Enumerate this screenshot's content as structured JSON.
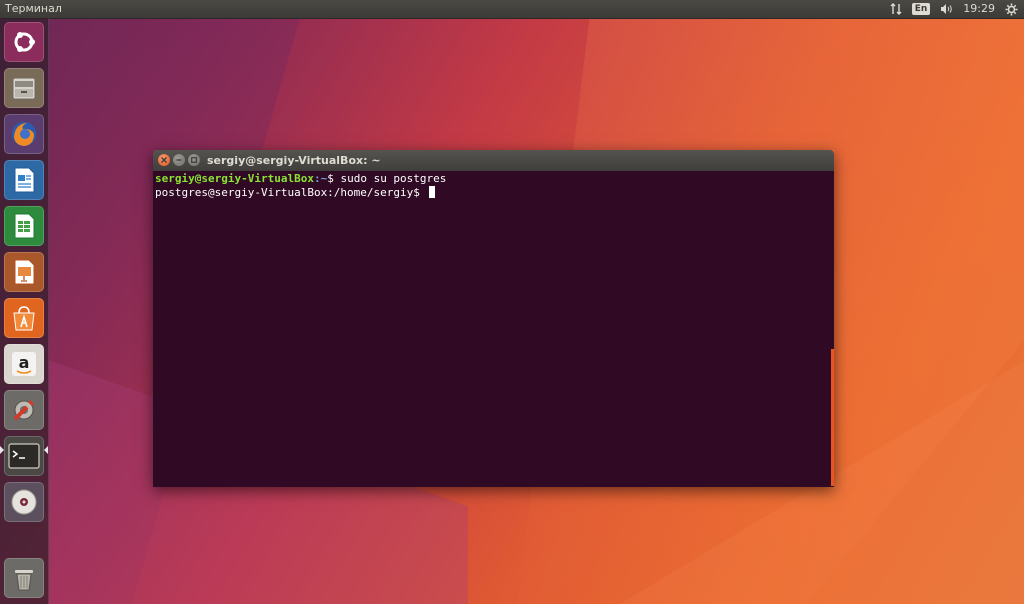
{
  "top_panel": {
    "title": "Терминал",
    "network_icon": "network-updown-icon",
    "keyboard_layout": "En",
    "volume_icon": "volume-icon",
    "clock": "19:29",
    "settings_icon": "gear-icon"
  },
  "launcher": {
    "items": [
      {
        "name": "ubuntu-dash",
        "icon": "ubuntu-logo-icon"
      },
      {
        "name": "files",
        "icon": "file-cabinet-icon"
      },
      {
        "name": "firefox",
        "icon": "firefox-icon"
      },
      {
        "name": "libreoffice-writer",
        "icon": "writer-document-icon"
      },
      {
        "name": "libreoffice-calc",
        "icon": "calc-spreadsheet-icon"
      },
      {
        "name": "libreoffice-impress",
        "icon": "impress-presentation-icon"
      },
      {
        "name": "ubuntu-software",
        "icon": "software-center-icon"
      },
      {
        "name": "amazon",
        "icon": "amazon-icon"
      },
      {
        "name": "system-settings",
        "icon": "settings-tools-icon"
      },
      {
        "name": "terminal",
        "icon": "terminal-icon",
        "active": true
      },
      {
        "name": "dvd-drive",
        "icon": "optical-disc-icon"
      },
      {
        "name": "trash",
        "icon": "trash-icon"
      }
    ]
  },
  "terminal_window": {
    "title": "sergiy@sergiy-VirtualBox: ~",
    "lines": [
      {
        "user_host": "sergiy@sergiy-VirtualBox",
        "path": ":~",
        "prompt": "$ ",
        "command": "sudo su postgres"
      },
      {
        "text": "postgres@sergiy-VirtualBox:/home/sergiy$ "
      }
    ],
    "colors": {
      "background": "#300a24",
      "user": "#8ae234",
      "path": "#729fcf",
      "scrollbar": "#e95420"
    }
  }
}
